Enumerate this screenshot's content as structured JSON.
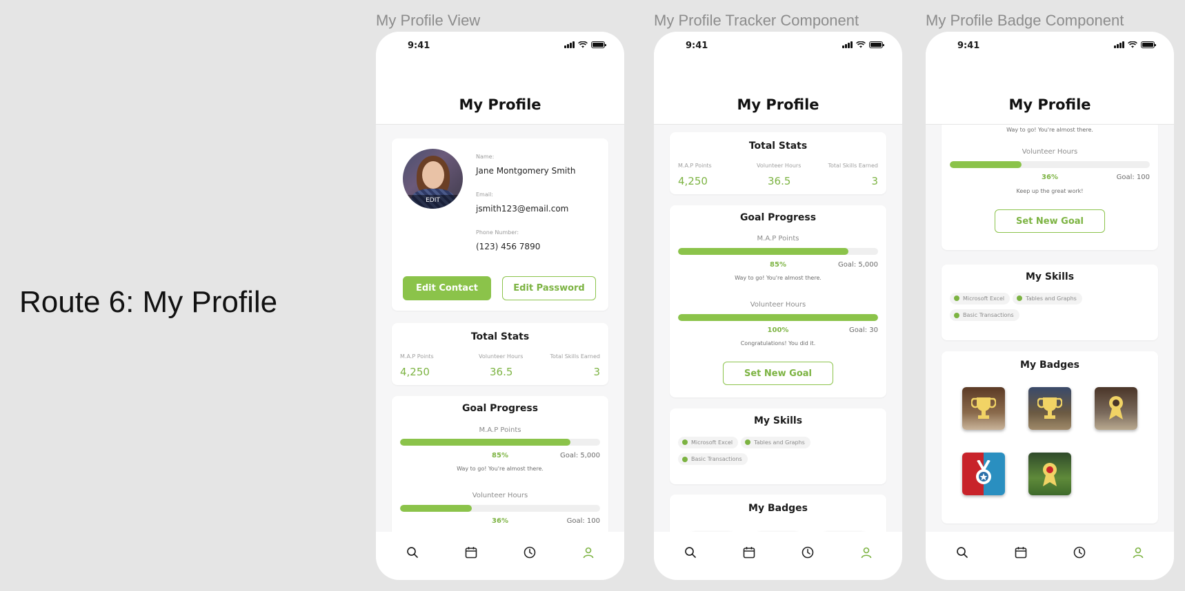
{
  "route_title": "Route 6: My Profile",
  "frame_labels": [
    "My Profile View",
    "My Profile Tracker Component",
    "My Profile Badge Component"
  ],
  "status_time": "9:41",
  "page_title": "My Profile",
  "profile": {
    "avatar_edit": "EDIT",
    "name_label": "Name:",
    "name": "Jane Montgomery Smith",
    "email_label": "Email:",
    "email": "jsmith123@email.com",
    "phone_label": "Phone Number:",
    "phone": "(123) 456 7890",
    "edit_contact": "Edit Contact",
    "edit_password": "Edit Password"
  },
  "total_stats": {
    "title": "Total Stats",
    "map_label": "M.A.P Points",
    "map_value": "4,250",
    "vol_label": "Volunteer Hours",
    "vol_value": "36.5",
    "skills_label": "Total Skills Earned",
    "skills_value": "3"
  },
  "goal_progress": {
    "title": "Goal Progress",
    "map": {
      "label": "M.A.P Points",
      "percent": 85,
      "percent_text": "85%",
      "goal": "Goal: 5,000",
      "message": "Way to go! You're almost there."
    },
    "map_tracker_message": "Way to go! You're almost  there.",
    "vol": {
      "label": "Volunteer Hours",
      "percent": 36,
      "percent_text": "36%",
      "goal": "Goal: 100",
      "message": "Keep up the great work!"
    },
    "vol_tracker": {
      "label": "Volunteer Hours",
      "percent": 100,
      "percent_text": "100%",
      "goal": "Goal: 30",
      "message": "Congratulations! You did it."
    },
    "set_new_goal": "Set New Goal"
  },
  "skills": {
    "title": "My Skills",
    "items": [
      "Microsoft Excel",
      "Tables and Graphs",
      "Basic Transactions"
    ]
  },
  "badges": {
    "title": "My Badges",
    "items": [
      "trophy-badge",
      "trophy-badge",
      "medal-badge",
      "medal-star-badge",
      "team-badge"
    ]
  },
  "nav": [
    "search-icon",
    "calendar-icon",
    "clock-icon",
    "profile-icon"
  ],
  "colors": {
    "accent": "#8bc34a",
    "accent_text": "#7cb342",
    "background": "#e5e5e5"
  }
}
